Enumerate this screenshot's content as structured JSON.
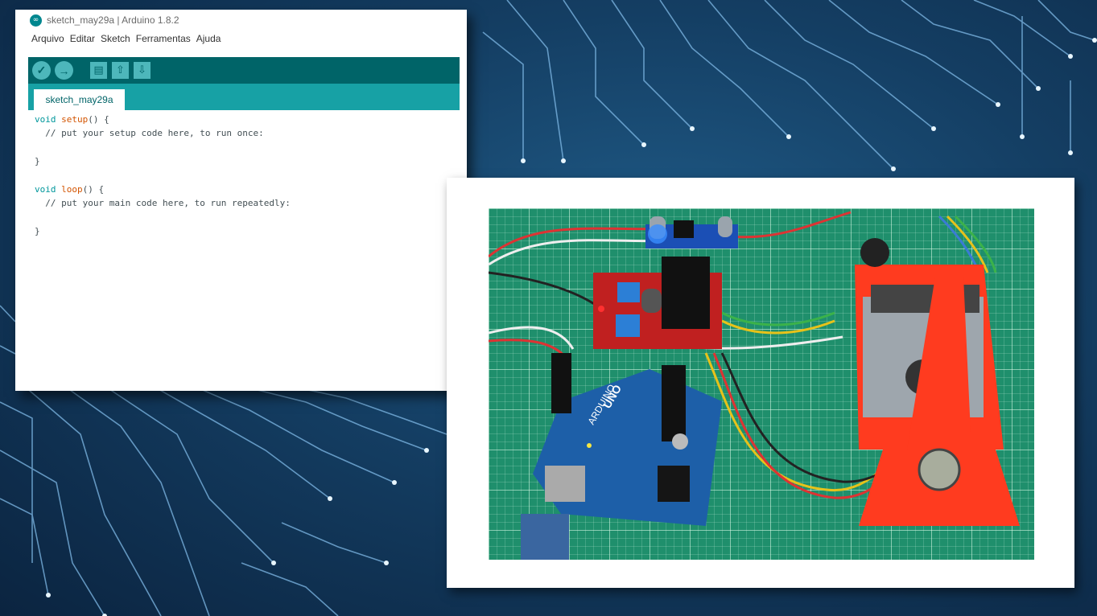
{
  "ide": {
    "window_title": "sketch_may29a | Arduino 1.8.2",
    "menu": [
      "Arquivo",
      "Editar",
      "Sketch",
      "Ferramentas",
      "Ajuda"
    ],
    "toolbar": {
      "verify_icon": "checkmark-icon",
      "upload_icon": "arrow-right-icon",
      "new_icon": "document-icon",
      "open_icon": "arrow-up-icon",
      "save_icon": "arrow-down-icon"
    },
    "tab": "sketch_may29a",
    "code": {
      "l1_kw": "void",
      "l1_fn": "setup",
      "l1_rest": "() {",
      "l2": "  // put your setup code here, to run once:",
      "l4": "}",
      "l6_kw": "void",
      "l6_fn": "loop",
      "l6_rest": "() {",
      "l7": "  // put your main code here, to run repeatedly:",
      "l9": "}"
    },
    "colors": {
      "toolbar": "#006468",
      "tabbar": "#17a1a5",
      "keyword": "#00979c",
      "function": "#d35400"
    }
  },
  "photo": {
    "board_label": "UNO",
    "board_brand": "ARDUINO",
    "colors": {
      "mat": "#1f8f6c",
      "mount": "#ff3b1f",
      "board": "#1d5fa8"
    }
  }
}
